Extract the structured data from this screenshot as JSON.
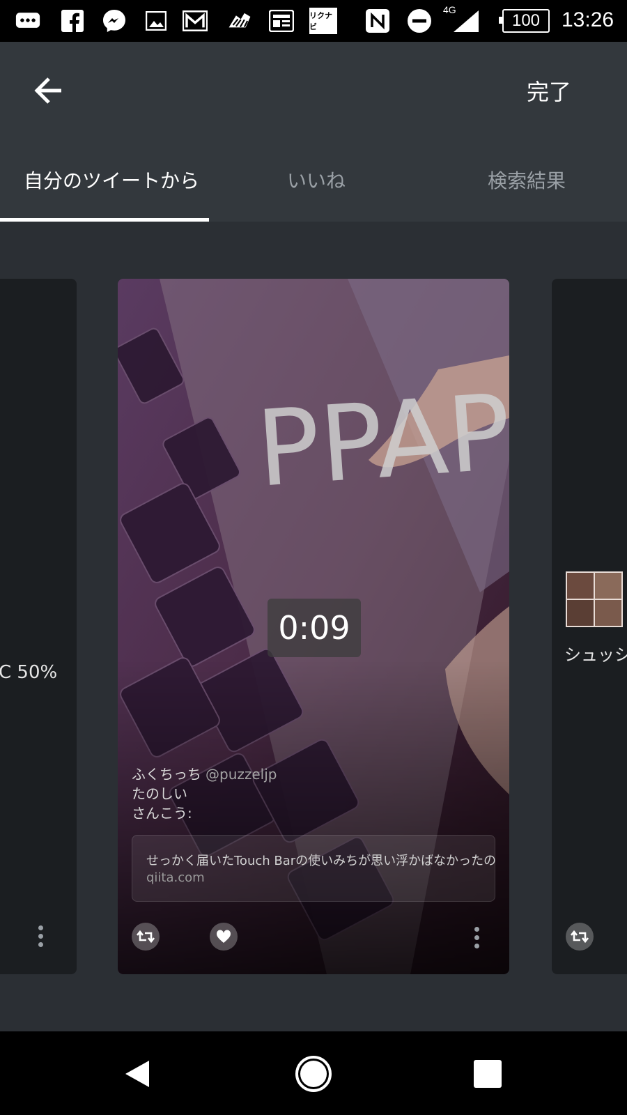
{
  "status_bar": {
    "network": "4G",
    "battery": "100",
    "time": "13:26",
    "icons": [
      "chat-bubble-icon",
      "facebook-icon",
      "messenger-icon",
      "gallery-icon",
      "gmail-icon",
      "zebra-app-icon",
      "news-icon",
      "rikunabi-icon",
      "nfc-icon",
      "dnd-icon",
      "signal-icon",
      "battery-icon"
    ],
    "rikunabi_label": "リクナビ"
  },
  "app_bar": {
    "done_label": "完了"
  },
  "tabs": [
    {
      "label": "自分のツイートから",
      "active": true
    },
    {
      "label": "いいね",
      "active": false
    },
    {
      "label": "検索結果",
      "active": false
    }
  ],
  "cards": {
    "left": {
      "text": "C 50%"
    },
    "main": {
      "image_text": "PPAP",
      "duration": "0:09",
      "author_name": "ふくちっち",
      "author_handle": "@puzzeljp",
      "tweet_line1": "たのしい",
      "tweet_line2": "さんこう:",
      "link_title": "せっかく届いたTouch Barの使いみちが思い浮かばなかったの",
      "link_domain": "qiita.com"
    },
    "right": {
      "text": "シュッシャ"
    }
  },
  "colors": {
    "background": "#2b2f34",
    "app_bar": "#33383d",
    "accent": "#ffffff"
  }
}
